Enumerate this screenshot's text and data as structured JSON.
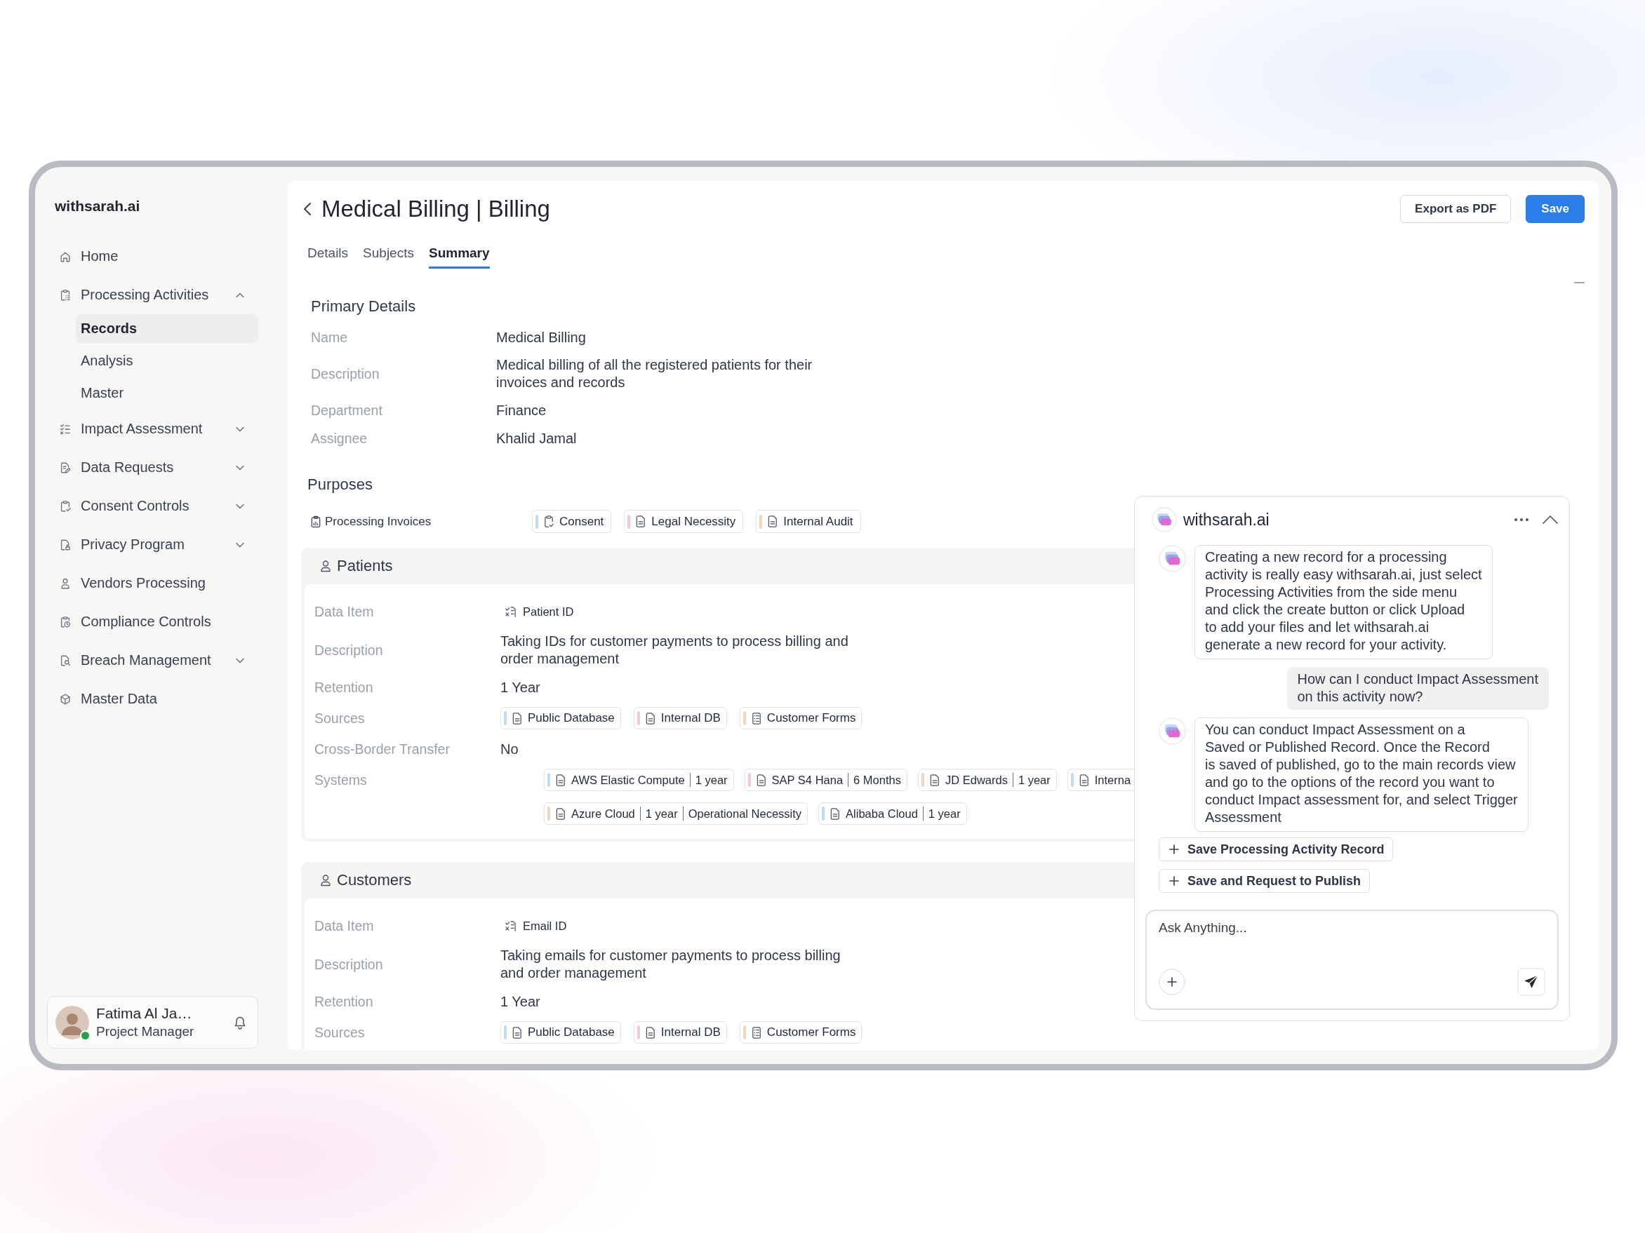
{
  "brand": {
    "name": "withsarah.ai"
  },
  "sidebar": {
    "items": [
      {
        "label": "Home",
        "selected": false
      },
      {
        "label": "Processing Activities",
        "selected": false,
        "expanded": true,
        "children": [
          {
            "label": "Records",
            "selected": true
          },
          {
            "label": "Analysis",
            "selected": false
          },
          {
            "label": "Master",
            "selected": false
          }
        ]
      },
      {
        "label": "Impact Assessment",
        "selected": false,
        "expanded": false
      },
      {
        "label": "Data Requests",
        "selected": false,
        "expanded": false
      },
      {
        "label": "Consent Controls",
        "selected": false,
        "expanded": false
      },
      {
        "label": "Privacy Program",
        "selected": false,
        "expanded": false
      },
      {
        "label": "Vendors Processing",
        "selected": false
      },
      {
        "label": "Compliance Controls",
        "selected": false
      },
      {
        "label": "Breach Management",
        "selected": false,
        "expanded": false
      },
      {
        "label": "Master Data",
        "selected": false
      }
    ]
  },
  "user": {
    "name": "Fatima Al Ja…",
    "role": "Project Manager",
    "online": true
  },
  "header": {
    "title": "Medical Billing | Billing",
    "export_button": {
      "label": "Export as PDF"
    },
    "save_button": {
      "label": "Save"
    }
  },
  "tabs": [
    {
      "label": "Details",
      "selected": false
    },
    {
      "label": "Subjects",
      "selected": false
    },
    {
      "label": "Summary",
      "selected": true
    }
  ],
  "primary_details": {
    "title": "Primary Details",
    "fields": [
      {
        "label": "Name",
        "kind": "text",
        "value": "Medical Billing"
      },
      {
        "label": "Description",
        "kind": "text",
        "value": "Medical billing of all the registered patients for their invoices and records"
      },
      {
        "label": "Department",
        "kind": "text",
        "value": "Finance"
      },
      {
        "label": "Assignee",
        "kind": "text",
        "value": "Khalid Jamal"
      }
    ]
  },
  "purposes": {
    "title": "Purposes",
    "items": [
      {
        "label": "Processing Invoices",
        "tags": [
          {
            "label": "Consent",
            "kind": "consent",
            "color": "#bfdbf5"
          },
          {
            "label": "Legal Necessity",
            "kind": "document",
            "color": "#f7c8d6"
          },
          {
            "label": "Internal Audit",
            "kind": "document",
            "color": "#f5d5b8"
          }
        ]
      }
    ]
  },
  "subjects": [
    {
      "title": "Patients",
      "fields": [
        {
          "label": "Data Item",
          "kind": "data_item",
          "value": "Patient ID"
        },
        {
          "label": "Description",
          "kind": "text",
          "value": "Taking IDs for customer payments to process billing and order management"
        },
        {
          "label": "Retention",
          "kind": "text",
          "value": "1 Year"
        },
        {
          "label": "Sources",
          "kind": "tags",
          "tags": [
            {
              "label": "Public Database",
              "kind": "document",
              "color": "#bfdbf5"
            },
            {
              "label": "Internal DB",
              "kind": "document",
              "color": "#f7c8d6"
            },
            {
              "label": "Customer Forms",
              "kind": "form",
              "color": "#f5d5b8"
            }
          ]
        },
        {
          "label": "Cross-Border Transfer",
          "kind": "text",
          "value": "No"
        },
        {
          "label": "Systems",
          "kind": "systems",
          "tags": [
            {
              "parts": [
                "AWS Elastic Compute",
                "1 year"
              ],
              "color": "#bfdbf5",
              "cut_off": false
            },
            {
              "parts": [
                "SAP S4 Hana",
                "6 Months"
              ],
              "color": "#f7c8d6",
              "cut_off": false
            },
            {
              "parts": [
                "JD Edwards",
                "1 year"
              ],
              "color": "#f5d5b8",
              "cut_off": false
            },
            {
              "parts": [
                "Interna"
              ],
              "color": "#bfdbf5",
              "cut_off": true
            },
            {
              "parts": [
                "Azure Cloud",
                "1 year",
                "Operational Necessity"
              ],
              "color": "#f5d5b8",
              "cut_off": false
            },
            {
              "parts": [
                "Alibaba Cloud",
                "1 year"
              ],
              "color": "#bfdbf5",
              "cut_off": false
            }
          ]
        }
      ]
    },
    {
      "title": "Customers",
      "fields": [
        {
          "label": "Data Item",
          "kind": "data_item",
          "value": "Email ID"
        },
        {
          "label": "Description",
          "kind": "text",
          "value": "Taking emails for customer payments to process billing and order management"
        },
        {
          "label": "Retention",
          "kind": "text",
          "value": "1 Year"
        },
        {
          "label": "Sources",
          "kind": "tags",
          "tags": [
            {
              "label": "Public Database",
              "kind": "document",
              "color": "#bfdbf5"
            },
            {
              "label": "Internal DB",
              "kind": "document",
              "color": "#f7c8d6"
            },
            {
              "label": "Customer Forms",
              "kind": "form",
              "color": "#f5d5b8"
            }
          ]
        }
      ]
    }
  ],
  "assistant": {
    "name": "withsarah.ai",
    "messages": [
      {
        "kind": "assistant",
        "text": "Creating a new record for a processing\nactivity is really easy withsarah.ai, just select\nProcessing Activities from the side menu\nand click the create button or click Upload\nto add your files and let withsarah.ai\ngenerate a new record for your activity."
      },
      {
        "kind": "user",
        "text": "How can I conduct Impact Assessment\non this activity now?"
      },
      {
        "kind": "assistant",
        "text": "You can conduct Impact Assessment on a\nSaved or Published Record. Once the Record\nis saved of published, go to the main records view\nand go to the options of the record you want to\nconduct Impact assessment for, and select Trigger\nAssessment"
      }
    ],
    "actions": [
      "Save Processing Activity Record",
      "Save and Request to Publish"
    ],
    "input": {
      "placeholder": "Ask Anything..."
    }
  }
}
